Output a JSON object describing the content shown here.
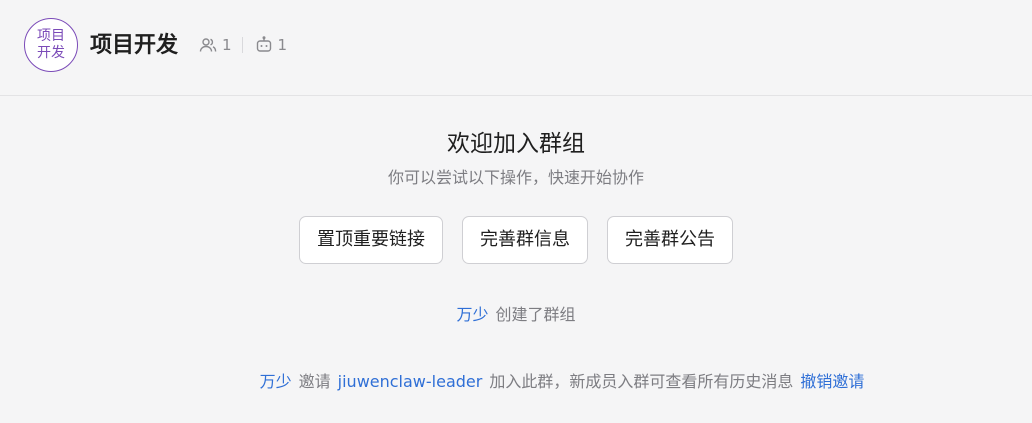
{
  "header": {
    "avatar_line1": "项目",
    "avatar_line2": "开发",
    "group_name": "项目开发",
    "member_count": "1",
    "bot_count": "1",
    "member_icon": "members-icon",
    "bot_icon": "robot-icon"
  },
  "welcome": {
    "title": "欢迎加入群组",
    "subtitle": "你可以尝试以下操作，快速开始协作",
    "actions": [
      {
        "label": "置顶重要链接"
      },
      {
        "label": "完善群信息"
      },
      {
        "label": "完善群公告"
      }
    ]
  },
  "system_messages": {
    "created": {
      "user": "万少",
      "text": "创建了群组"
    },
    "invited": {
      "user": "万少",
      "verb": "邀请",
      "invitee": "jiuwenclaw-leader",
      "text": "加入此群，新成员入群可查看所有历史消息",
      "revoke": "撤销邀请"
    }
  },
  "colors": {
    "accent_link": "#2f6fd6",
    "avatar_purple": "#7b4bb8"
  }
}
